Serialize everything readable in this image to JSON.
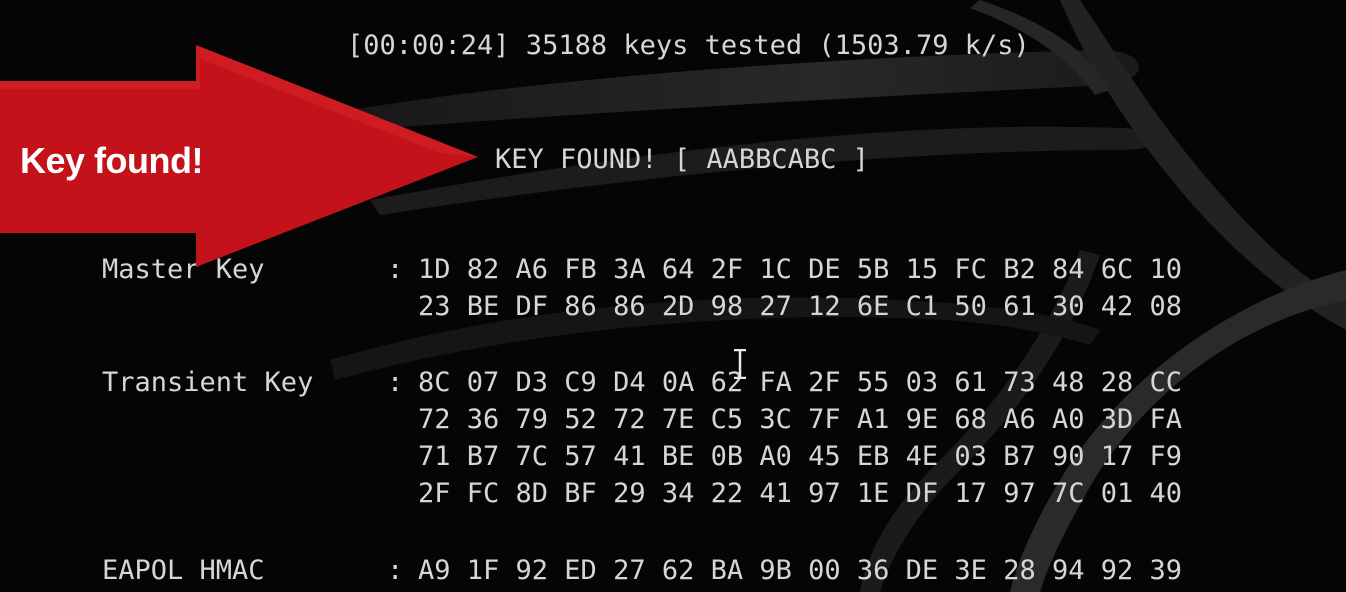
{
  "terminal": {
    "status_line": "[00:00:24] 35188 keys tested (1503.79 k/s)",
    "key_found_line": "KEY FOUND! [ AABBCABC ]"
  },
  "callout": {
    "text": "Key found!",
    "arrow_color": "#c4121a"
  },
  "sections": {
    "master_key": {
      "label": "Master Key",
      "rows": [
        "1D 82 A6 FB 3A 64 2F 1C DE 5B 15 FC B2 84 6C 10",
        "23 BE DF 86 86 2D 98 27 12 6E C1 50 61 30 42 08"
      ]
    },
    "transient_key": {
      "label": "Transient Key",
      "rows": [
        "8C 07 D3 C9 D4 0A 62 FA 2F 55 03 61 73 48 28 CC",
        "72 36 79 52 72 7E C5 3C 7F A1 9E 68 A6 A0 3D FA",
        "71 B7 7C 57 41 BE 0B A0 45 EB 4E 03 B7 90 17 F9",
        "2F FC 8D BF 29 34 22 41 97 1E DF 17 97 7C 01 40"
      ]
    },
    "eapol_hmac": {
      "label": "EAPOL HMAC",
      "rows": [
        "A9 1F 92 ED 27 62 BA 9B 00 36 DE 3E 28 94 92 39"
      ]
    }
  },
  "colors": {
    "terminal_bg": "#050505",
    "terminal_text": "#d6d6d6",
    "callout_text": "#ffffff"
  }
}
